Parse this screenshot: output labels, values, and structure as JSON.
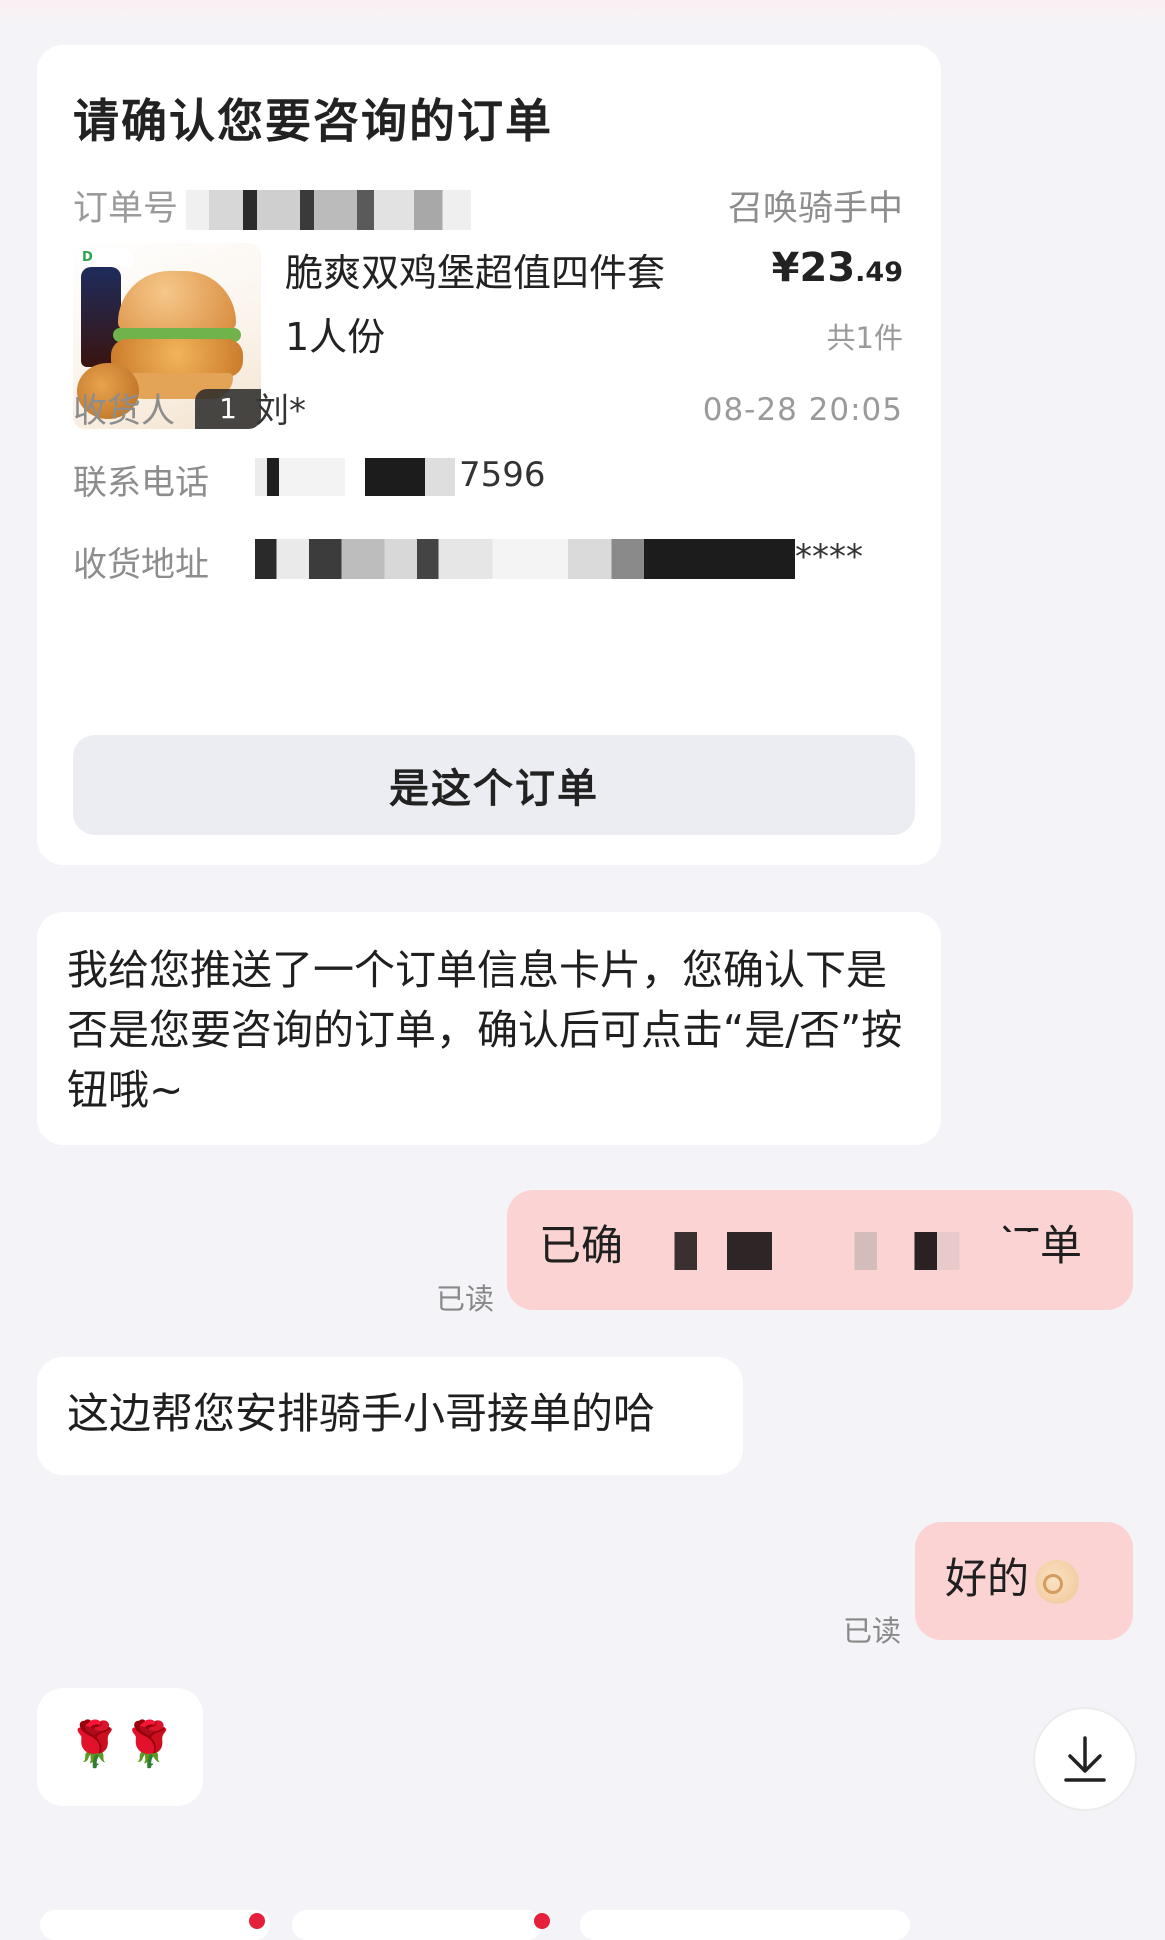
{
  "order_card": {
    "title": "请确认您要咨询的订单",
    "order_no_label": "订单号",
    "status": "召唤骑手中",
    "product": {
      "name": "脆爽双鸡堡超值四件套 1人份",
      "currency": "¥",
      "price_main": "23",
      "price_decimal": ".49",
      "qty_text": "共1件",
      "qty_badge": "1",
      "time": "08-28 20:05"
    },
    "recipient_label": "收货人",
    "recipient_value": "刘*",
    "phone_label": "联系电话",
    "phone_visible": "7596",
    "address_label": "收货地址",
    "address_visible": "****",
    "confirm_button": "是这个订单"
  },
  "messages": [
    {
      "side": "in",
      "text": "我给您推送了一个订单信息卡片，您确认下是否是您要咨询的订单，确认后可点击“是/否”按钮哦~"
    },
    {
      "side": "out",
      "text": "已确认…订单",
      "prefix": "已确",
      "suffix": "订单",
      "status": "已读"
    },
    {
      "side": "in",
      "text": "这边帮您安排骑手小哥接单的哈"
    },
    {
      "side": "out",
      "text": "好的",
      "emoji": "ok-hand",
      "status": "已读"
    },
    {
      "side": "in",
      "text": "🌹🌹"
    }
  ],
  "colors": {
    "background": "#f4f4f8",
    "bubble_in": "#ffffff",
    "bubble_out": "#fcd3d3",
    "button_bg": "#ecedf2",
    "badge_red": "#e5203a"
  }
}
